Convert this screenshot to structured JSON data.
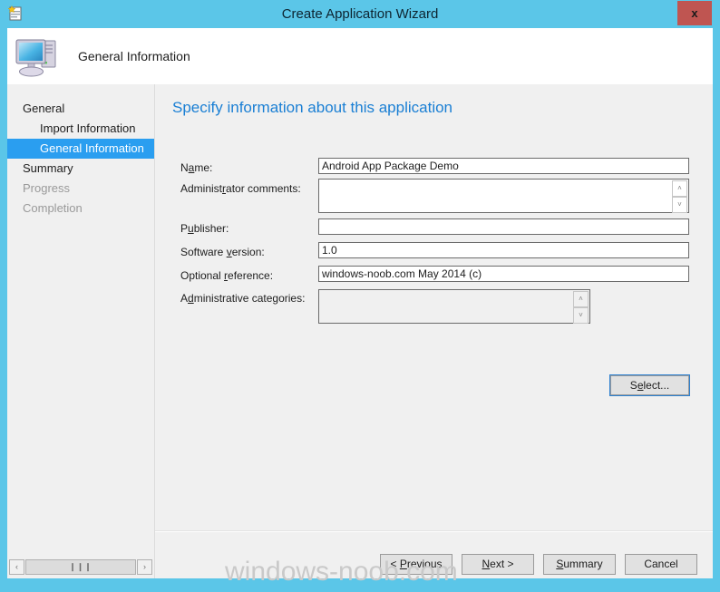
{
  "window": {
    "title": "Create Application Wizard",
    "close_label": "x",
    "titlebar_icon": "wizard-document-icon",
    "frame_color": "#5bc6e8",
    "titlebar_color": "#5bc6e8",
    "close_button_color": "#bf5551"
  },
  "header": {
    "title": "General Information",
    "icon": "computer-icon",
    "background": "#ffffff"
  },
  "sidebar": {
    "items": [
      {
        "label": "General",
        "level": 0,
        "state": "normal"
      },
      {
        "label": "Import Information",
        "level": 1,
        "state": "normal"
      },
      {
        "label": "General Information",
        "level": 1,
        "state": "selected"
      },
      {
        "label": "Summary",
        "level": 0,
        "state": "normal"
      },
      {
        "label": "Progress",
        "level": 0,
        "state": "disabled"
      },
      {
        "label": "Completion",
        "level": 0,
        "state": "disabled"
      }
    ],
    "selected_color": "#2a9ef0",
    "scrollbar": {
      "left_arrow": "‹",
      "right_arrow": "›",
      "thumb_grip": "❙❙❙"
    }
  },
  "content": {
    "heading": "Specify information about this application",
    "heading_color": "#1a7fd4",
    "fields": [
      {
        "label_pre": "N",
        "label_acc": "a",
        "label_post": "me:",
        "value": "Android App Package Demo",
        "type": "text"
      },
      {
        "label_pre": "Administ",
        "label_acc": "r",
        "label_post": "ator comments:",
        "value": "",
        "type": "textarea"
      },
      {
        "label_pre": "P",
        "label_acc": "u",
        "label_post": "blisher:",
        "value": "",
        "type": "text"
      },
      {
        "label_pre": "Software ",
        "label_acc": "v",
        "label_post": "ersion:",
        "value": "1.0",
        "type": "text"
      },
      {
        "label_pre": "Optional ",
        "label_acc": "r",
        "label_post": "eference:",
        "value": "windows-noob.com May 2014 (c)",
        "type": "text"
      },
      {
        "label_pre": "A",
        "label_acc": "d",
        "label_post": "ministrative categories:",
        "value": "",
        "type": "textarea-disabled"
      }
    ],
    "select_button": {
      "pre": "S",
      "acc": "e",
      "post": "lect..."
    },
    "spinner": {
      "up": "˄",
      "down": "˅"
    }
  },
  "footer": {
    "buttons": [
      {
        "pre": "< ",
        "acc": "P",
        "post": "revious"
      },
      {
        "pre": "",
        "acc": "N",
        "post": "ext >"
      },
      {
        "pre": "",
        "acc": "S",
        "post": "ummary"
      },
      {
        "pre": "",
        "acc": "",
        "post": "Cancel"
      }
    ]
  },
  "watermark": {
    "text": "windows-noob.com"
  }
}
